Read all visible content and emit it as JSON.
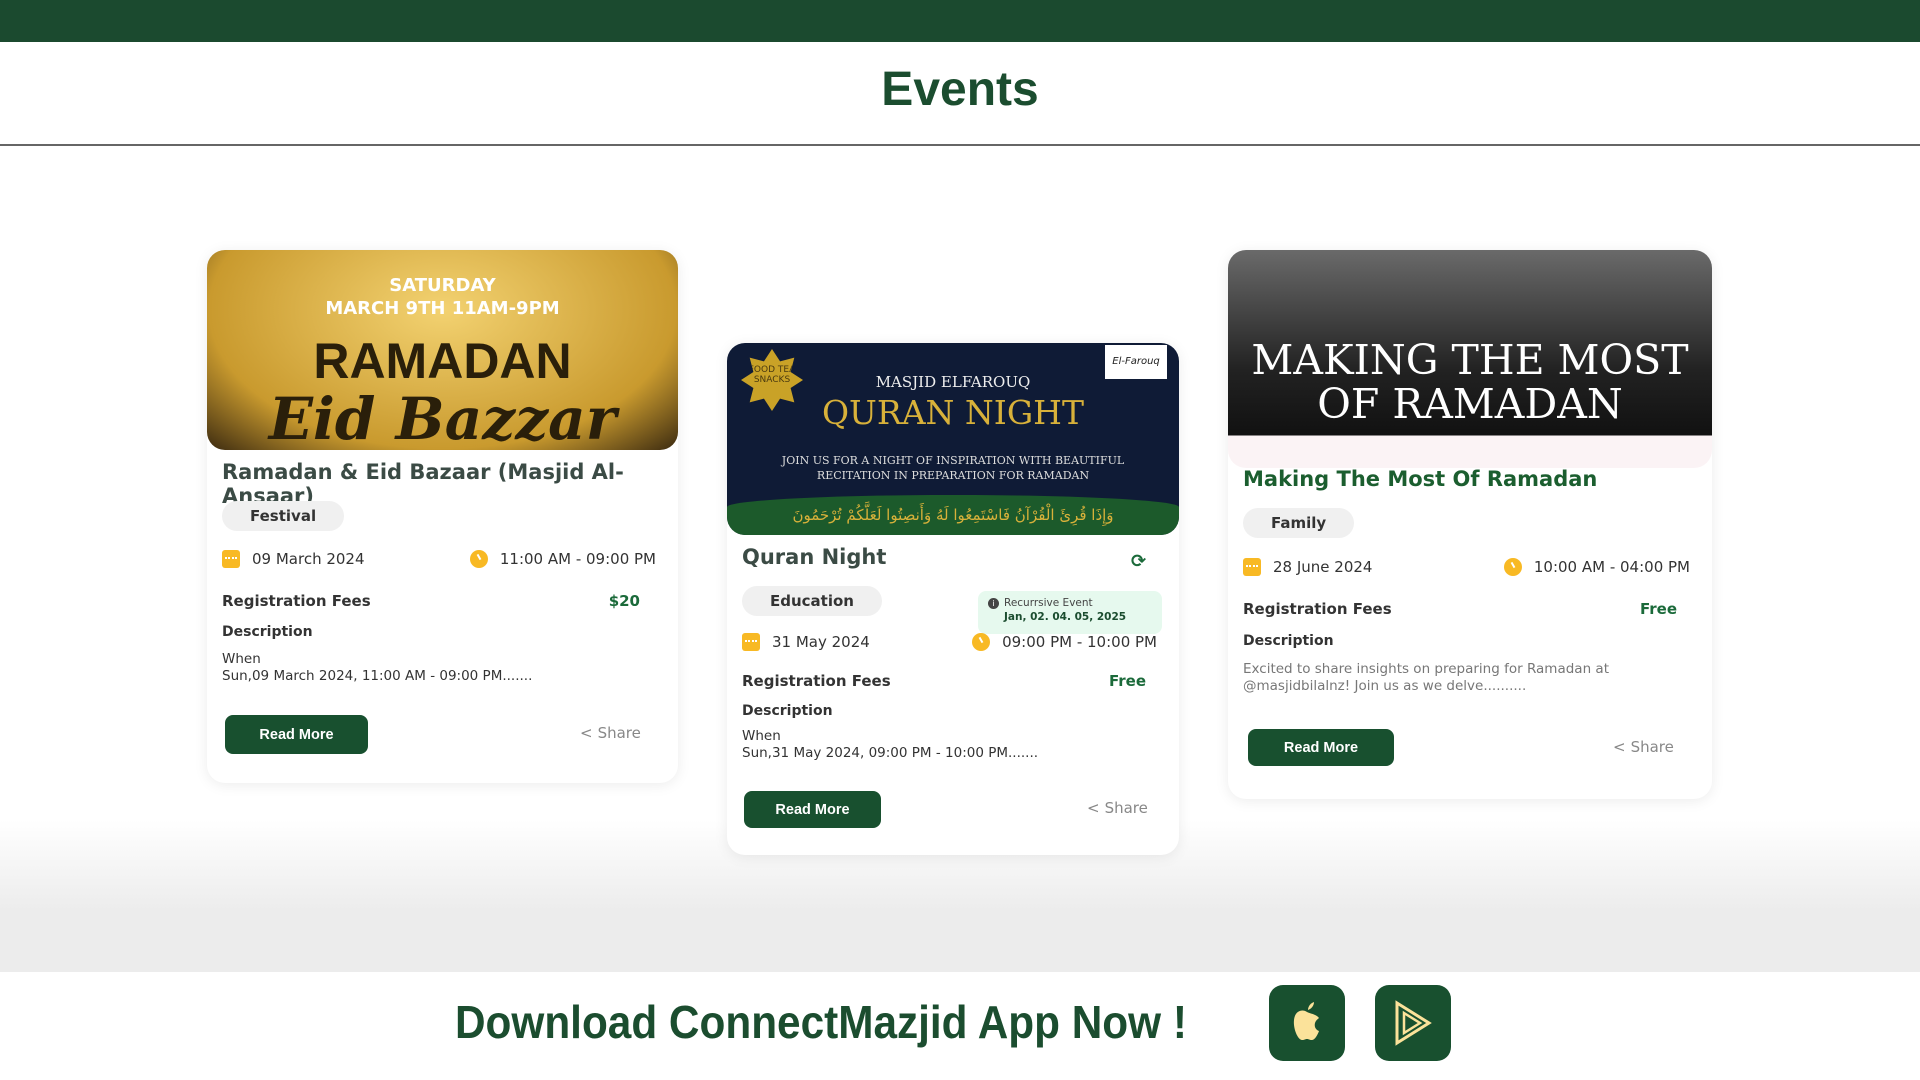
{
  "header": {
    "title": "Events"
  },
  "events": [
    {
      "image_text": [
        "SATURDAY",
        "MARCH 9TH 11AM-9PM",
        "RAMADAN",
        "Eid Bazzar"
      ],
      "title": "Ramadan & Eid Bazaar (Masjid Al-Ansaar)",
      "category": "Festival",
      "date": "09 March 2024",
      "time": "11:00 AM - 09:00 PM",
      "fees_label": "Registration Fees",
      "fees": "$20",
      "description_label": "Description",
      "description": [
        "When",
        "Sun,09 March 2024, 11:00 AM - 09:00 PM......."
      ],
      "read_more": "Read More",
      "share": "Share"
    },
    {
      "image_text": [
        "FOOD TEA SNACKS",
        "MASJID ELFAROUQ",
        "QURAN NIGHT",
        "JOIN US FOR A NIGHT OF INSPIRATION WITH BEAUTIFUL RECITATION IN PREPARATION FOR RAMADAN",
        "وَإِذَا قُرِئَ الْقُرْآنُ فَاسْتَمِعُوا لَهُ وَأَنصِتُوا لَعَلَّكُمْ تُرْحَمُونَ",
        "El-Farouq"
      ],
      "title": "Quran Night",
      "category": "Education",
      "date": "31 May 2024",
      "time": "09:00 PM - 10:00 PM",
      "fees_label": "Registration Fees",
      "fees": "Free",
      "description_label": "Description",
      "description": [
        "When",
        "Sun,31 May 2024, 09:00 PM - 10:00 PM......."
      ],
      "read_more": "Read More",
      "share": "Share",
      "recurring_tooltip": {
        "label": "Recurrsive Event",
        "dates": "Jan, 02. 04. 05, 2025"
      }
    },
    {
      "image_text": [
        "MAKING THE MOST",
        "OF RAMADAN"
      ],
      "title": "Making The Most Of Ramadan",
      "category": "Family",
      "date": "28 June 2024",
      "time": "10:00 AM - 04:00 PM",
      "fees_label": "Registration Fees",
      "fees": "Free",
      "description_label": "Description",
      "description": [
        "Excited to share insights on preparing for Ramadan at",
        "@masjidbilalnz! Join us as we delve.........."
      ],
      "read_more": "Read More",
      "share": "Share"
    }
  ],
  "footer": {
    "download_text": "Download ConnectMazjid App Now !",
    "app_store_icon": "apple-icon",
    "play_store_icon": "play-icon"
  },
  "colors": {
    "brand": "#1b4a2f",
    "accent": "#f8b924",
    "fee": "#1b6a3a"
  }
}
